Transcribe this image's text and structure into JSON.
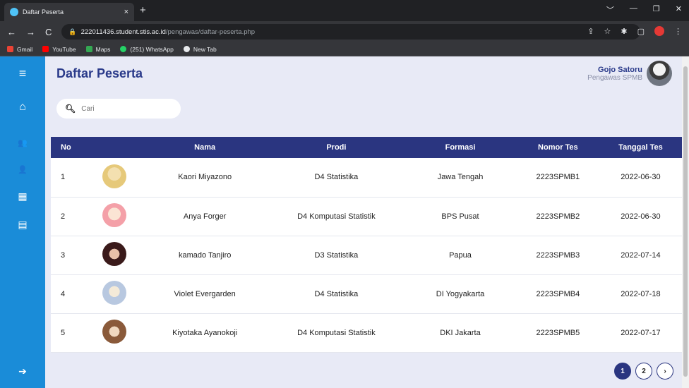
{
  "browser": {
    "tab_title": "Daftar Peserta",
    "tab_close": "×",
    "new_tab": "+",
    "url_host": "222011436.student.stis.ac.id",
    "url_path": "/pengawas/daftar-peserta.php",
    "window_controls": [
      "﹀",
      "—",
      "❐",
      "✕"
    ],
    "nav": [
      "←",
      "→",
      "C"
    ],
    "bookmarks": [
      {
        "label": "Gmail",
        "color": "#ea4335"
      },
      {
        "label": "YouTube",
        "color": "#ff0000"
      },
      {
        "label": "Maps",
        "color": "#34a853"
      },
      {
        "label": "(251) WhatsApp",
        "color": "#25d366"
      },
      {
        "label": "New Tab",
        "color": "#e8eaed"
      }
    ]
  },
  "header": {
    "title": "Daftar Peserta",
    "user_name": "Gojo Satoru",
    "user_role": "Pengawas SPMB"
  },
  "sidebar": {
    "items": [
      {
        "icon": "menu-icon",
        "glyph": "≡"
      },
      {
        "icon": "home-icon",
        "glyph": "⌂"
      },
      {
        "icon": "users-icon",
        "glyph": "👥"
      },
      {
        "icon": "user-icon",
        "glyph": "👤"
      },
      {
        "icon": "calendar-icon",
        "glyph": "▦"
      },
      {
        "icon": "document-icon",
        "glyph": "▤"
      },
      {
        "icon": "logout-icon",
        "glyph": "➔"
      }
    ]
  },
  "search": {
    "placeholder": "Cari"
  },
  "table": {
    "headers": [
      "No",
      "",
      "Nama",
      "Prodi",
      "Formasi",
      "Nomor Tes",
      "Tanggal Tes"
    ],
    "rows": [
      {
        "no": "1",
        "nama": "Kaori Miyazono",
        "prodi": "D4 Statistika",
        "formasi": "Jawa Tengah",
        "nomor": "2223SPMB1",
        "tanggal": "2022-06-30",
        "avatar_color": "#e6c97a"
      },
      {
        "no": "2",
        "nama": "Anya Forger",
        "prodi": "D4 Komputasi Statistik",
        "formasi": "BPS Pusat",
        "nomor": "2223SPMB2",
        "tanggal": "2022-06-30",
        "avatar_color": "#f4a0a8"
      },
      {
        "no": "3",
        "nama": "kamado Tanjiro",
        "prodi": "D3 Statistika",
        "formasi": "Papua",
        "nomor": "2223SPMB3",
        "tanggal": "2022-07-14",
        "avatar_color": "#6a2a2a"
      },
      {
        "no": "4",
        "nama": "Violet Evergarden",
        "prodi": "D4 Statistika",
        "formasi": "DI Yogyakarta",
        "nomor": "2223SPMB4",
        "tanggal": "2022-07-18",
        "avatar_color": "#b8c8e0"
      },
      {
        "no": "5",
        "nama": "Kiyotaka Ayanokoji",
        "prodi": "D4 Komputasi Statistik",
        "formasi": "DKI Jakarta",
        "nomor": "2223SPMB5",
        "tanggal": "2022-07-17",
        "avatar_color": "#8a5a3a"
      }
    ]
  },
  "pagination": {
    "pages": [
      "1",
      "2"
    ],
    "next": "›",
    "current": "1"
  }
}
